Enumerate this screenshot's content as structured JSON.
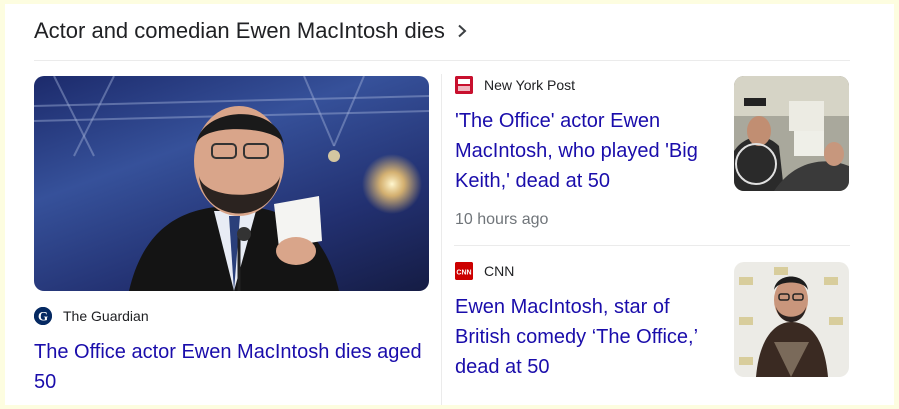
{
  "header": {
    "title": "Actor and comedian Ewen MacIntosh dies"
  },
  "stories": [
    {
      "source": "The Guardian",
      "headline": "The Office actor Ewen MacIntosh dies aged 50"
    },
    {
      "source": "New York Post",
      "headline": "'The Office' actor Ewen MacIntosh, who played 'Big Keith,' dead at 50",
      "time": "10 hours ago"
    },
    {
      "source": "CNN",
      "headline": "Ewen MacIntosh, star of British comedy ‘The Office,’ dead at 50"
    }
  ],
  "colors": {
    "link": "#1a0dab",
    "text": "#202124",
    "muted": "#70757a",
    "page_bg": "#fdfde0",
    "cnn_red": "#cc0000",
    "nypost_red": "#c8102e"
  },
  "icons": {
    "heading": "chevron-right-icon",
    "guardian": "guardian-logo-icon",
    "nypost": "new-york-post-logo-icon",
    "cnn": "cnn-logo-icon"
  }
}
